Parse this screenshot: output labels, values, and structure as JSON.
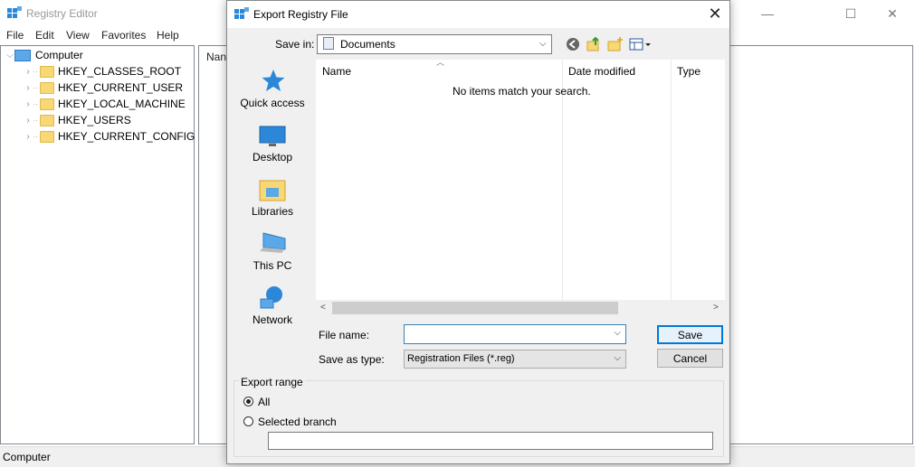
{
  "main_window": {
    "title": "Registry Editor",
    "controls": {
      "minimize": "—",
      "maximize": "☐",
      "close": "✕"
    },
    "menu": [
      "File",
      "Edit",
      "View",
      "Favorites",
      "Help"
    ],
    "tree": {
      "root": "Computer",
      "items": [
        "HKEY_CLASSES_ROOT",
        "HKEY_CURRENT_USER",
        "HKEY_LOCAL_MACHINE",
        "HKEY_USERS",
        "HKEY_CURRENT_CONFIG"
      ]
    },
    "right_pane_header": "Nan",
    "status": "Computer"
  },
  "dialog": {
    "title": "Export Registry File",
    "close": "✕",
    "save_in_label": "Save in:",
    "save_in_value": "Documents",
    "places": [
      "Quick access",
      "Desktop",
      "Libraries",
      "This PC",
      "Network"
    ],
    "columns": [
      "Name",
      "Date modified",
      "Type"
    ],
    "empty_message": "No items match your search.",
    "file_name_label": "File name:",
    "file_name_value": "",
    "save_as_type_label": "Save as type:",
    "save_as_type_value": "Registration Files (*.reg)",
    "save_button": "Save",
    "cancel_button": "Cancel",
    "export_range_label": "Export range",
    "radio_all": "All",
    "radio_selected": "Selected branch",
    "branch_value": ""
  },
  "icons": [
    "registry-app-icon",
    "document-icon",
    "back-icon",
    "up-folder-icon",
    "new-folder-icon",
    "view-menu-icon",
    "star-icon",
    "desktop-icon",
    "libraries-icon",
    "pc-icon",
    "network-icon"
  ],
  "colors": {
    "accent": "#0078d7",
    "folder": "#f8d775",
    "quick_access_blue": "#2b88d8"
  }
}
